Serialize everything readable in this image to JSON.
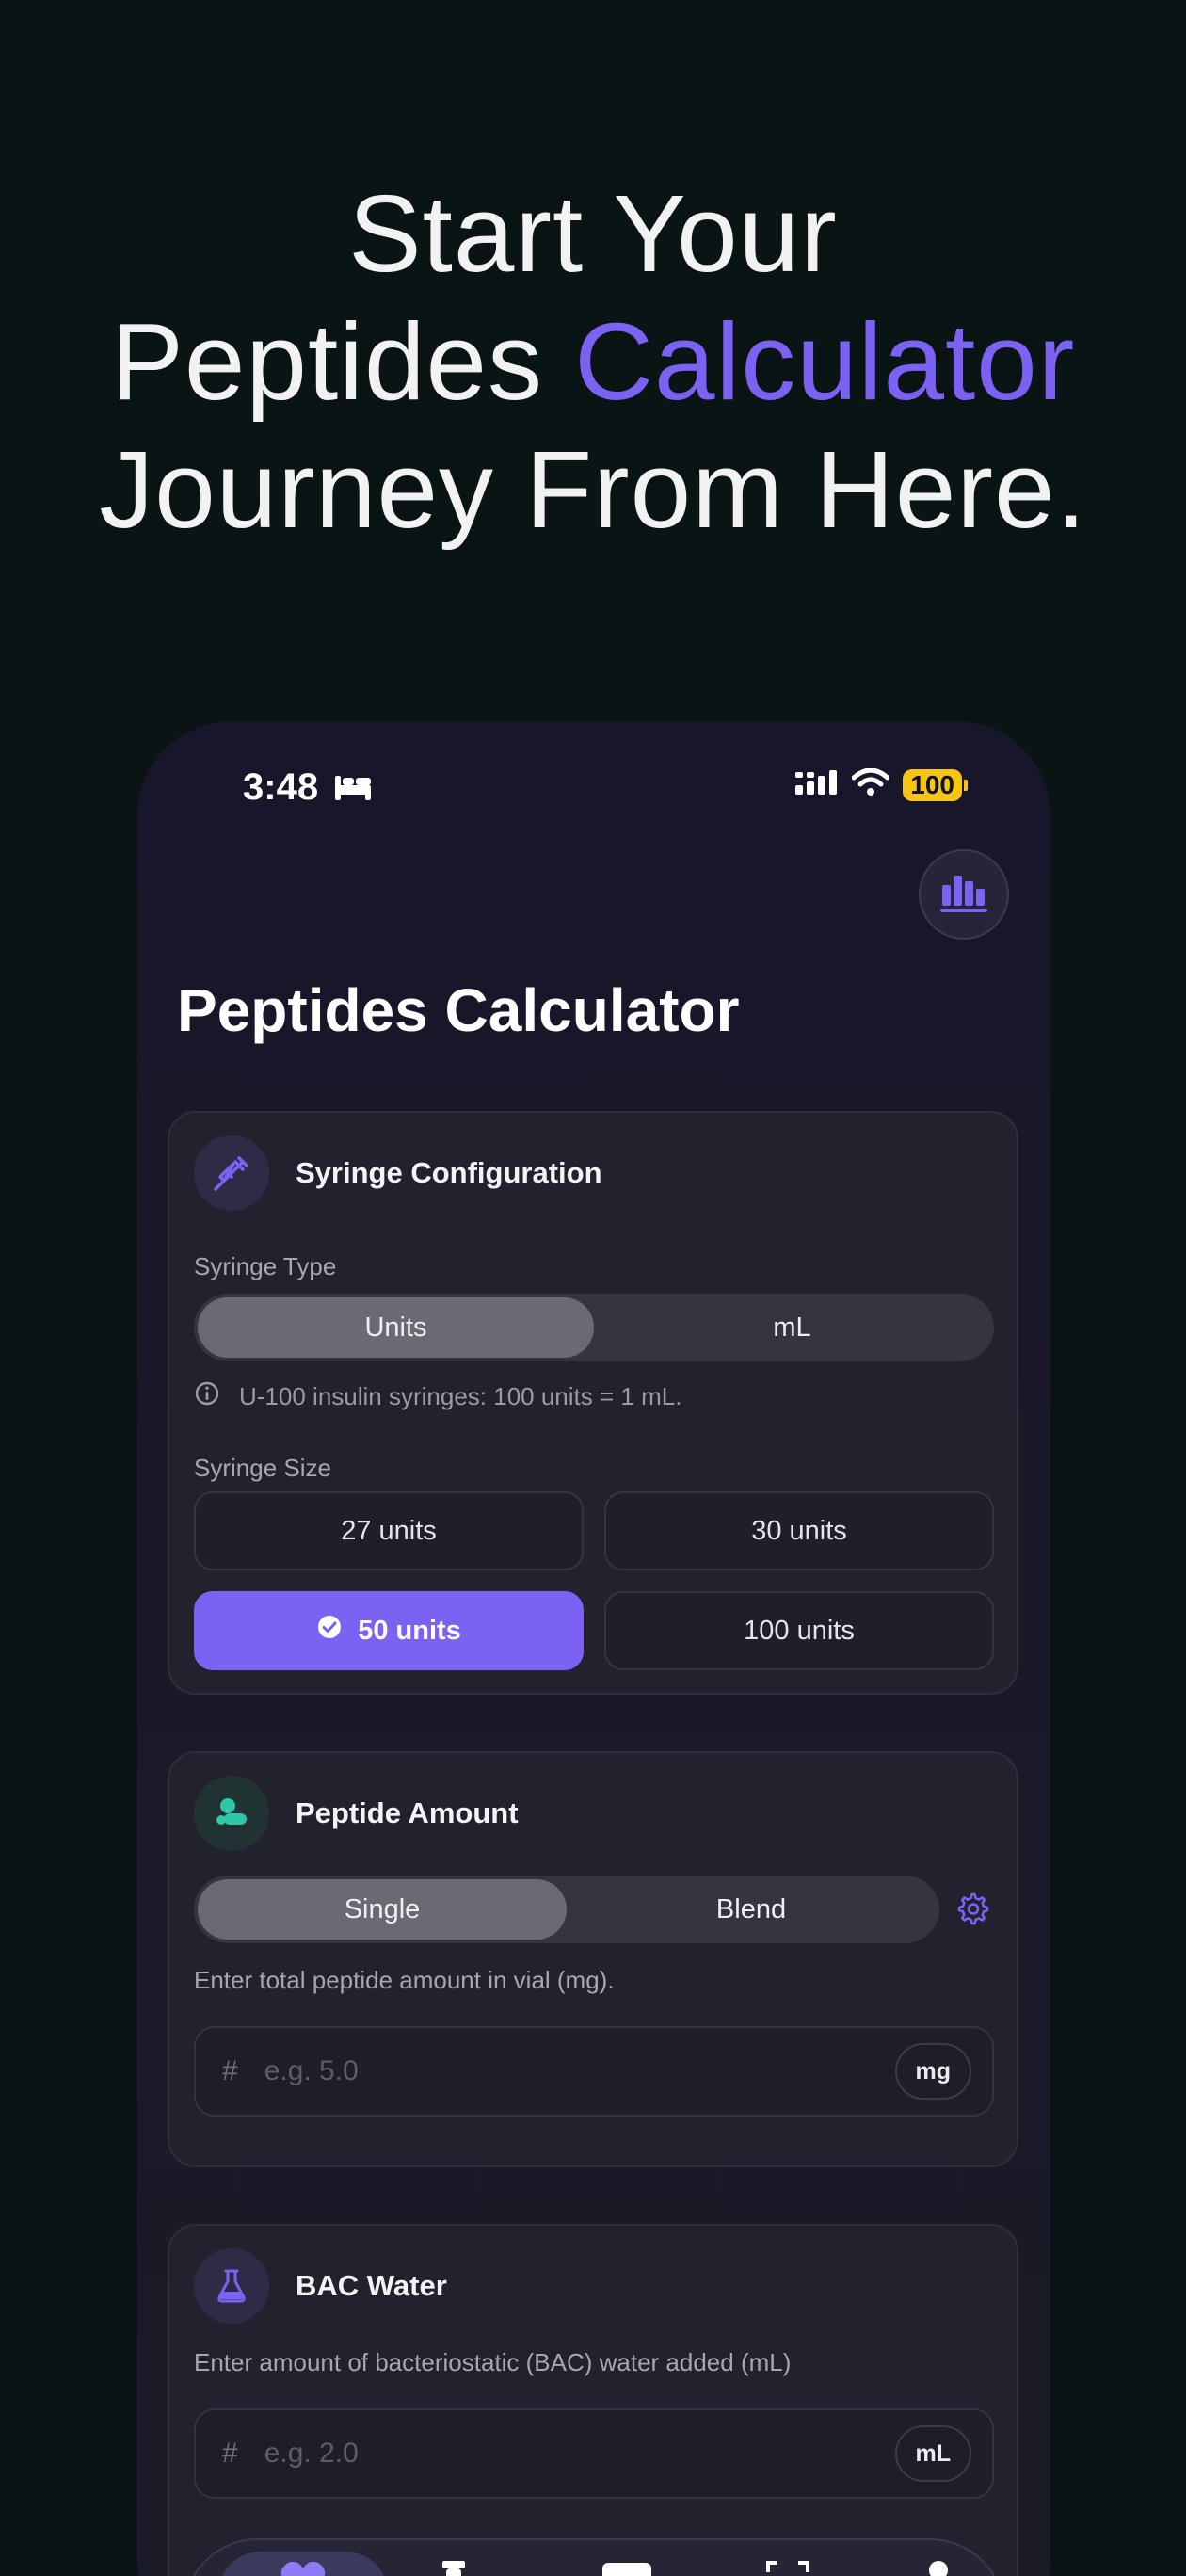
{
  "headline": {
    "line1": "Start Your",
    "line2_pre": "Peptides ",
    "line2_accent": "Calculator",
    "line3": "Journey From Here."
  },
  "status_bar": {
    "time": "3:48",
    "battery": "100"
  },
  "app": {
    "title": "Peptides Calculator"
  },
  "syringe_card": {
    "title": "Syringe Configuration",
    "type_label": "Syringe Type",
    "type_options": [
      "Units",
      "mL"
    ],
    "type_selected": "Units",
    "info": "U-100 insulin syringes: 100 units = 1 mL.",
    "size_label": "Syringe Size",
    "sizes": [
      "27 units",
      "30 units",
      "50 units",
      "100 units"
    ],
    "size_selected": "50 units"
  },
  "peptide_card": {
    "title": "Peptide Amount",
    "mode_options": [
      "Single",
      "Blend"
    ],
    "mode_selected": "Single",
    "hint": "Enter total peptide amount in vial (mg).",
    "placeholder": "e.g. 5.0",
    "unit": "mg"
  },
  "bac_card": {
    "title": "BAC Water",
    "hint": "Enter amount of bacteriostatic (BAC) water added (mL)",
    "placeholder": "e.g. 2.0",
    "unit": "mL"
  },
  "colors": {
    "accent": "#7b62f2",
    "background": "#0a1414",
    "card": "#22222e",
    "battery": "#f5c517",
    "teal": "#2fc7a8"
  },
  "icons": {
    "status": [
      "bed-icon",
      "signal-icon",
      "wifi-icon",
      "battery-icon"
    ],
    "stats": "bar-chart-icon",
    "syringe": "syringe-icon",
    "info": "info-icon",
    "check": "check-circle-icon",
    "peptide": "pills-icon",
    "settings": "gear-icon",
    "bac": "flask-icon",
    "nav": [
      "heart-icon",
      "vial-icon",
      "card-icon",
      "scan-icon",
      "profile-icon"
    ]
  }
}
